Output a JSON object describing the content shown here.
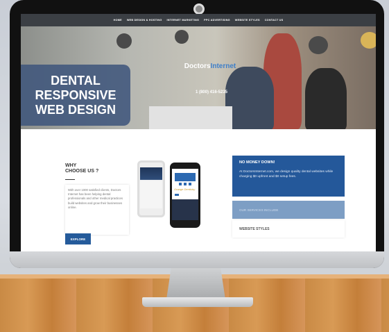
{
  "nav": {
    "items": [
      "HOME",
      "WEB DESIGN & HOSTING",
      "INTERNET MARKETING",
      "PPC ADVERTISING",
      "WEBSITE STYLES",
      "CONTACT US"
    ]
  },
  "hero": {
    "title_lines": [
      "DENTAL",
      "RESPONSIVE",
      "WEB DESIGN"
    ],
    "logo_part1": "Doctors",
    "logo_part2": "Internet",
    "phone": "1 (800) 416-5235"
  },
  "why": {
    "heading_line1": "WHY",
    "heading_line2": "CHOOSE US ?",
    "body": "With over 1000 satisfied clients, Doctors Internet has been helping dental professionals and other medical practices build websites and grow their businesses online.",
    "button": "EXPLORE"
  },
  "phones": {
    "script_text": "Orange Dentistry"
  },
  "offer": {
    "heading": "NO MONEY DOWN!",
    "text": "At DoctorsInternet.com, we design quality dental websites while charging $0 upfront and $0 setup fees."
  },
  "services": {
    "label": "OUR SERVICES INCLUDE"
  },
  "styles": {
    "label": "WEBSITE STYLES"
  },
  "colors": {
    "accent": "#24589a",
    "nav_bg": "#3b3f44",
    "hero_box": "#40567c"
  }
}
